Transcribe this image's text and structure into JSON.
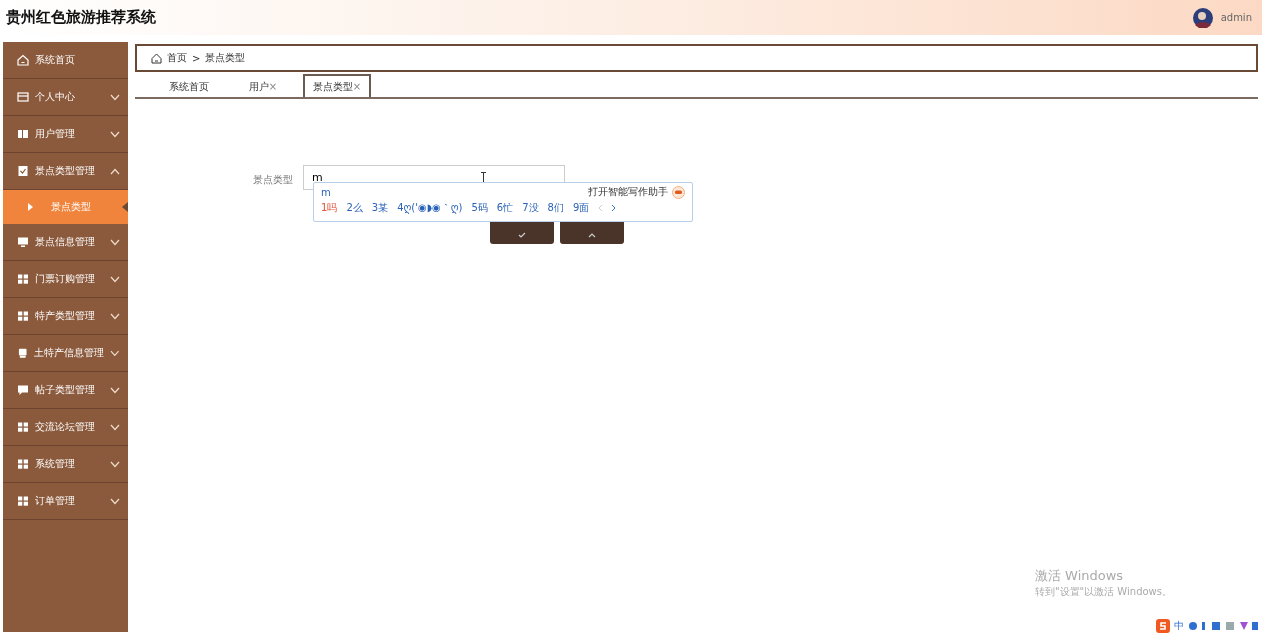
{
  "header": {
    "title": "贵州红色旅游推荐系统",
    "user": "admin"
  },
  "sidebar": {
    "items": [
      {
        "label": "系统首页",
        "kind": "home"
      },
      {
        "label": "个人中心",
        "kind": "card",
        "expanded": false
      },
      {
        "label": "用户管理",
        "kind": "book",
        "expanded": false
      },
      {
        "label": "景点类型管理",
        "kind": "clipboard",
        "expanded": true,
        "children": [
          {
            "label": "景点类型",
            "selected": true
          }
        ]
      },
      {
        "label": "景点信息管理",
        "kind": "monitor",
        "expanded": false
      },
      {
        "label": "门票订购管理",
        "kind": "grid",
        "expanded": false
      },
      {
        "label": "特产类型管理",
        "kind": "grid",
        "expanded": false
      },
      {
        "label": "土特产信息管理",
        "kind": "printer",
        "expanded": false
      },
      {
        "label": "帖子类型管理",
        "kind": "chat",
        "expanded": false
      },
      {
        "label": "交流论坛管理",
        "kind": "grid",
        "expanded": false
      },
      {
        "label": "系统管理",
        "kind": "grid",
        "expanded": false
      },
      {
        "label": "订单管理",
        "kind": "grid",
        "expanded": false
      }
    ]
  },
  "breadcrumb": {
    "separator": ">",
    "items": [
      "首页",
      "景点类型"
    ]
  },
  "tabs": [
    {
      "label": "系统首页",
      "selected": false
    },
    {
      "label": "用户",
      "close": "×",
      "selected": false
    },
    {
      "label": "景点类型",
      "close": "×",
      "selected": true
    }
  ],
  "form": {
    "label": "景点类型",
    "value": "m"
  },
  "buttons": [
    {
      "kind": "submit"
    },
    {
      "kind": "cancel"
    }
  ],
  "ime": {
    "composition": "m",
    "assistant": "打开智能写作助手",
    "candidates": [
      "1吗",
      "2么",
      "3某",
      "4ღ('◉◗◉｀ღ)",
      "5码",
      "6忙",
      "7没",
      "8们",
      "9面"
    ]
  },
  "activation": {
    "title": "激活 Windows",
    "hint": "转到\"设置\"以激活 Windows。"
  },
  "tray": {
    "input_mode": "中"
  }
}
